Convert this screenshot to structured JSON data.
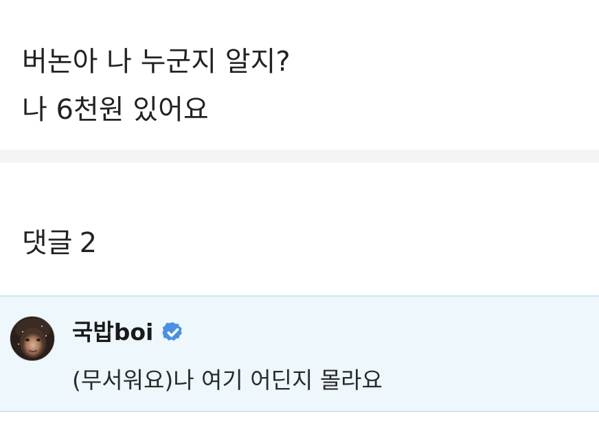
{
  "post": {
    "lines": [
      "버논아 나 누군지 알지?",
      "나 6천원 있어요"
    ]
  },
  "comments_section": {
    "label": "댓글",
    "count": "2"
  },
  "comments": [
    {
      "author": "국밥boi",
      "verified": true,
      "text": "(무서워요)나 여기 어딘지 몰라요",
      "avatar_icon": "profile-photo-icon"
    }
  ],
  "colors": {
    "comment_bg": "#edf7fc",
    "divider_bg": "#f4f4f7",
    "verified_badge": "#4a90e2"
  }
}
